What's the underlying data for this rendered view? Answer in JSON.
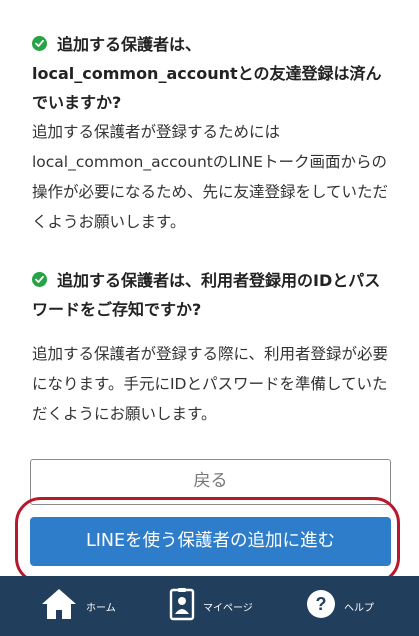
{
  "questions": [
    {
      "title": "追加する保護者は、local_common_accountとの友達登録は済んでいますか?",
      "body": "追加する保護者が登録するためにはlocal_common_accountのLINEトーク画面からの操作が必要になるため、先に友達登録をしていただくようお願いします。"
    },
    {
      "title": "追加する保護者は、利用者登録用のIDとパスワードをご存知ですか?",
      "body": "追加する保護者が登録する際に、利用者登録が必要になります。手元にIDとパスワードを準備していただくようにお願いします。"
    }
  ],
  "buttons": {
    "back_label": "戻る",
    "proceed_label": "LINEを使う保護者の追加に進む"
  },
  "nav": {
    "home_label": "ホーム",
    "mypage_label": "マイページ",
    "help_label": "ヘルプ"
  },
  "icons": {
    "check": "check-circle-icon",
    "home": "home-icon",
    "mypage": "id-card-icon",
    "help": "help-icon"
  },
  "colors": {
    "check_green": "#27a245",
    "primary_button": "#2e7dca",
    "nav_background": "#213e5c",
    "highlight_frame": "#b8182b"
  }
}
